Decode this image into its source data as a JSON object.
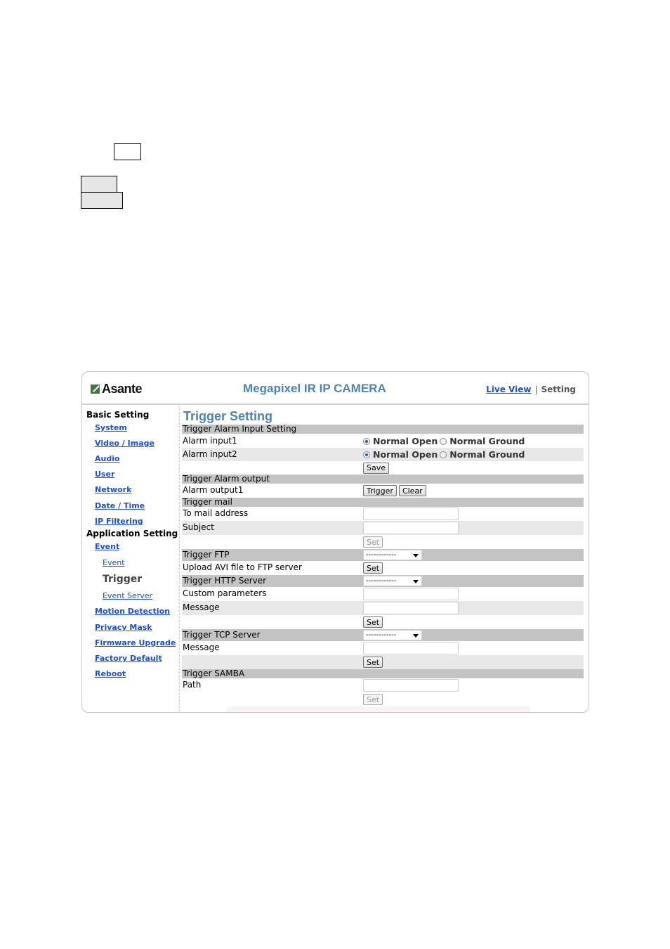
{
  "header": {
    "brand": "Asante",
    "title": "Megapixel IR IP CAMERA",
    "nav": {
      "live_view": "Live View",
      "separator": "|",
      "setting": "Setting"
    }
  },
  "sidebar": {
    "basic_heading": "Basic Setting",
    "basic_items": [
      "System",
      "Video / Image",
      "Audio",
      "User",
      "Network",
      "Date / Time",
      "IP Filtering"
    ],
    "app_heading": "Application Setting",
    "event": "Event",
    "event_sub": [
      "Event",
      "Trigger",
      "Event Server"
    ],
    "app_items": [
      "Motion Detection",
      "Privacy Mask",
      "Firmware Upgrade",
      "Factory Default",
      "Reboot"
    ],
    "current": "Trigger"
  },
  "main": {
    "page_title": "Trigger Setting",
    "alarm_input": {
      "section": "Trigger Alarm Input Setting",
      "inputs": [
        {
          "label": "Alarm input1",
          "options": [
            "Normal Open",
            "Normal Ground"
          ],
          "selected": "Normal Open"
        },
        {
          "label": "Alarm input2",
          "options": [
            "Normal Open",
            "Normal Ground"
          ],
          "selected": "Normal Open"
        }
      ],
      "save": "Save"
    },
    "alarm_output": {
      "section": "Trigger Alarm output",
      "label": "Alarm output1",
      "trigger": "Trigger",
      "clear": "Clear"
    },
    "mail": {
      "section": "Trigger mail",
      "to_label": "To mail address",
      "to_value": "",
      "subject_label": "Subject",
      "subject_value": "",
      "set": "Set"
    },
    "ftp": {
      "section": "Trigger FTP",
      "selected": "------------",
      "upload_label": "Upload AVI file to FTP server",
      "set": "Set"
    },
    "http": {
      "section": "Trigger HTTP Server",
      "selected": "------------",
      "params_label": "Custom parameters",
      "params_value": "",
      "message_label": "Message",
      "message_value": "",
      "set": "Set"
    },
    "tcp": {
      "section": "Trigger TCP Server",
      "selected": "------------",
      "message_label": "Message",
      "message_value": "",
      "set": "Set"
    },
    "samba": {
      "section": "Trigger SAMBA",
      "path_label": "Path",
      "path_value": "",
      "set": "Set"
    }
  }
}
